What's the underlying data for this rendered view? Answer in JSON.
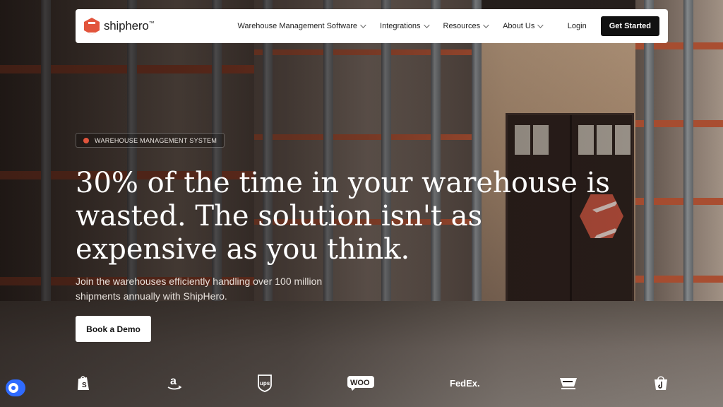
{
  "nav": {
    "brand": "shiphero",
    "brand_tm": "™",
    "menu": [
      {
        "label": "Warehouse Management Software"
      },
      {
        "label": "Integrations"
      },
      {
        "label": "Resources"
      },
      {
        "label": "About Us"
      }
    ],
    "login": "Login",
    "cta": "Get Started"
  },
  "hero": {
    "badge": "WAREHOUSE MANAGEMENT SYSTEM",
    "headline": "30% of the time in your warehouse is wasted. The solution isn't as expensive as you think.",
    "subtext": "Join the warehouses efficiently handling over 100 million shipments annually with ShipHero.",
    "demo_button": "Book a Demo"
  },
  "logos": {
    "amazon": "a",
    "ups": "ups",
    "woo": "WOO",
    "fedex": "FedEx."
  },
  "colors": {
    "brand": "#e2543c",
    "cta_bg": "#111111",
    "toggle": "#2f6bff"
  }
}
